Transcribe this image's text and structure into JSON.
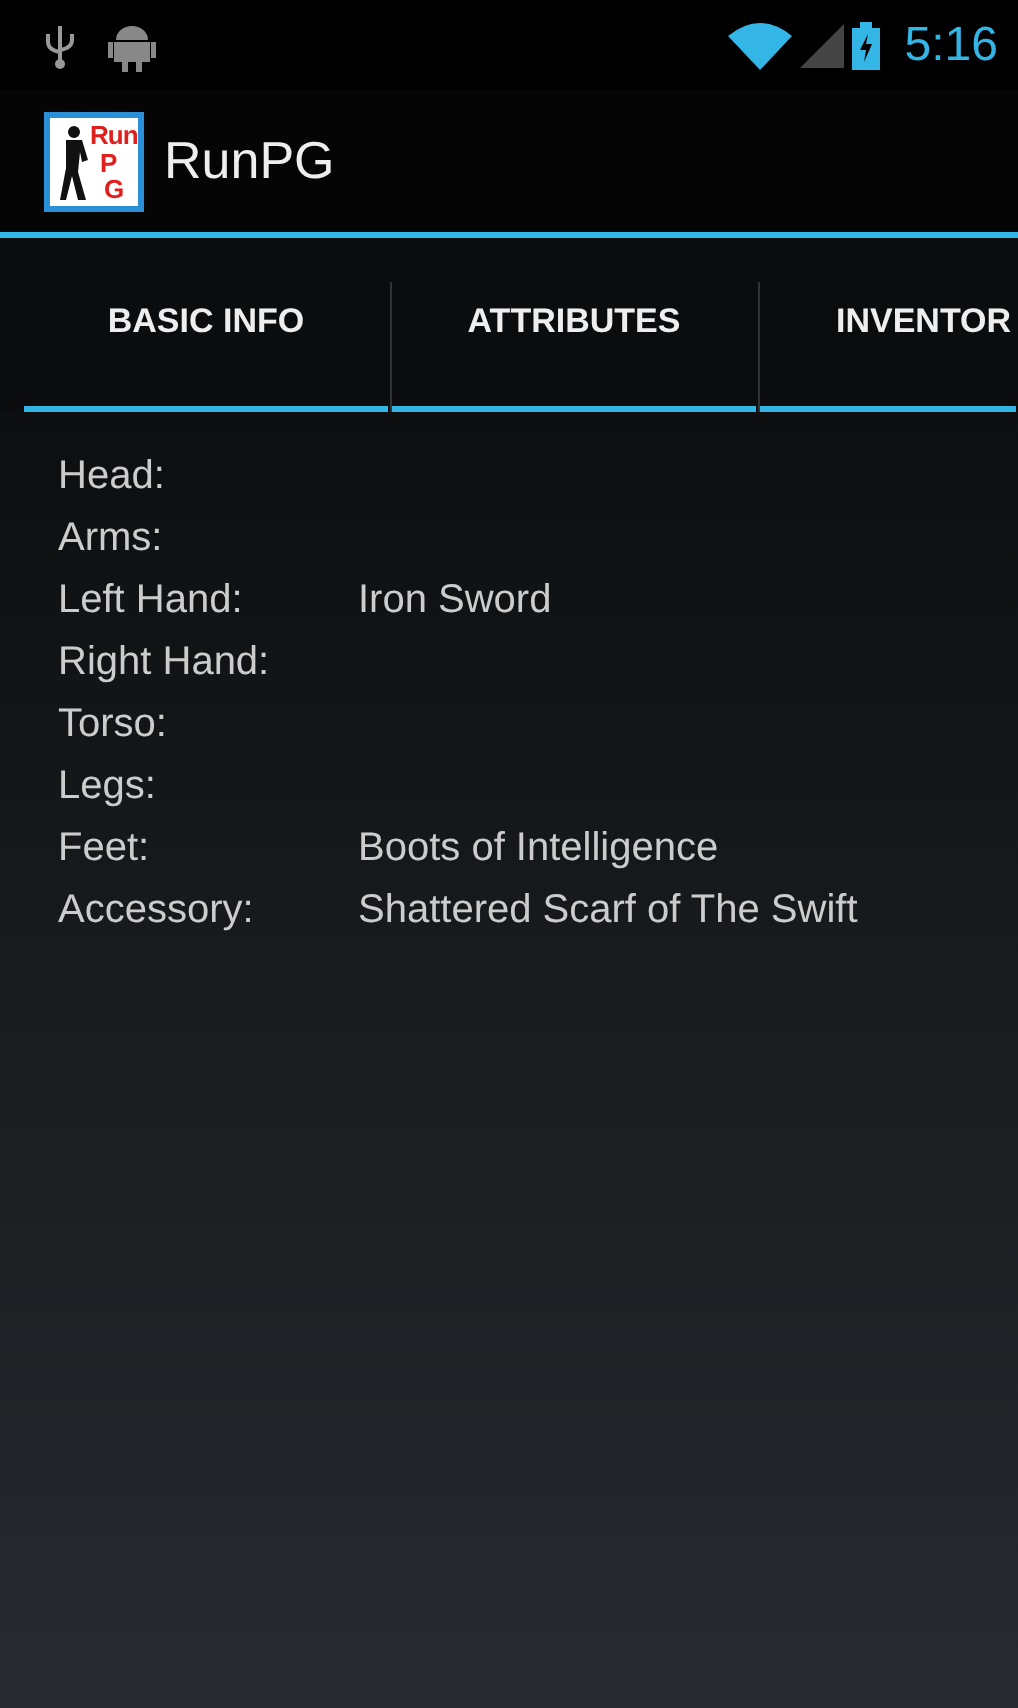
{
  "status_bar": {
    "time": "5:16"
  },
  "action_bar": {
    "logo_lines": [
      "Run",
      "P",
      "G"
    ],
    "title": "RunPG"
  },
  "tabs": [
    {
      "label": "BASIC INFO"
    },
    {
      "label": "ATTRIBUTES"
    },
    {
      "label": "INVENTOR"
    }
  ],
  "equipment": [
    {
      "slot": "Head:"
    },
    {
      "slot": "Arms:"
    },
    {
      "slot": "Left Hand:",
      "item": "Iron Sword"
    },
    {
      "slot": "Right Hand:"
    },
    {
      "slot": "Torso:"
    },
    {
      "slot": "Legs:"
    },
    {
      "slot": "Feet:",
      "item": "Boots of Intelligence"
    },
    {
      "slot": "Accessory:",
      "item": "Shattered Scarf of The Swift"
    }
  ]
}
